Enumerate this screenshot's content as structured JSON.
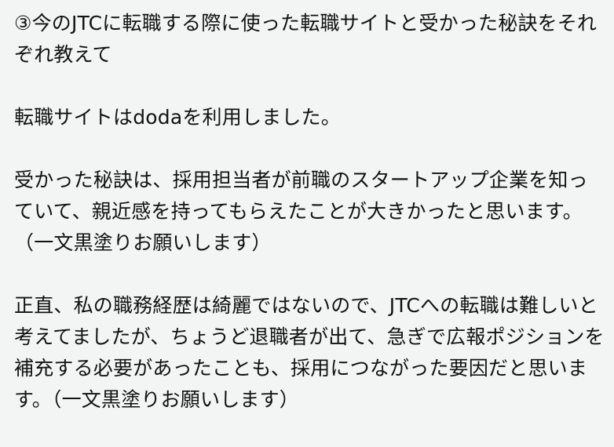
{
  "paragraphs": [
    "③今のJTCに転職する際に使った転職サイトと受かった秘訣をそれぞれ教えて",
    "転職サイトはdodaを利用しました。",
    "受かった秘訣は、採用担当者が前職のスタートアップ企業を知っていて、親近感を持ってもらえたことが大きかったと思います。（一文黒塗りお願いします）",
    "正直、私の職務経歴は綺麗ではないので、JTCへの転職は難しいと考えてましたが、ちょうど退職者が出て、急ぎで広報ポジションを補充する必要があったことも、採用につながった要因だと思います。（一文黒塗りお願いします）"
  ]
}
